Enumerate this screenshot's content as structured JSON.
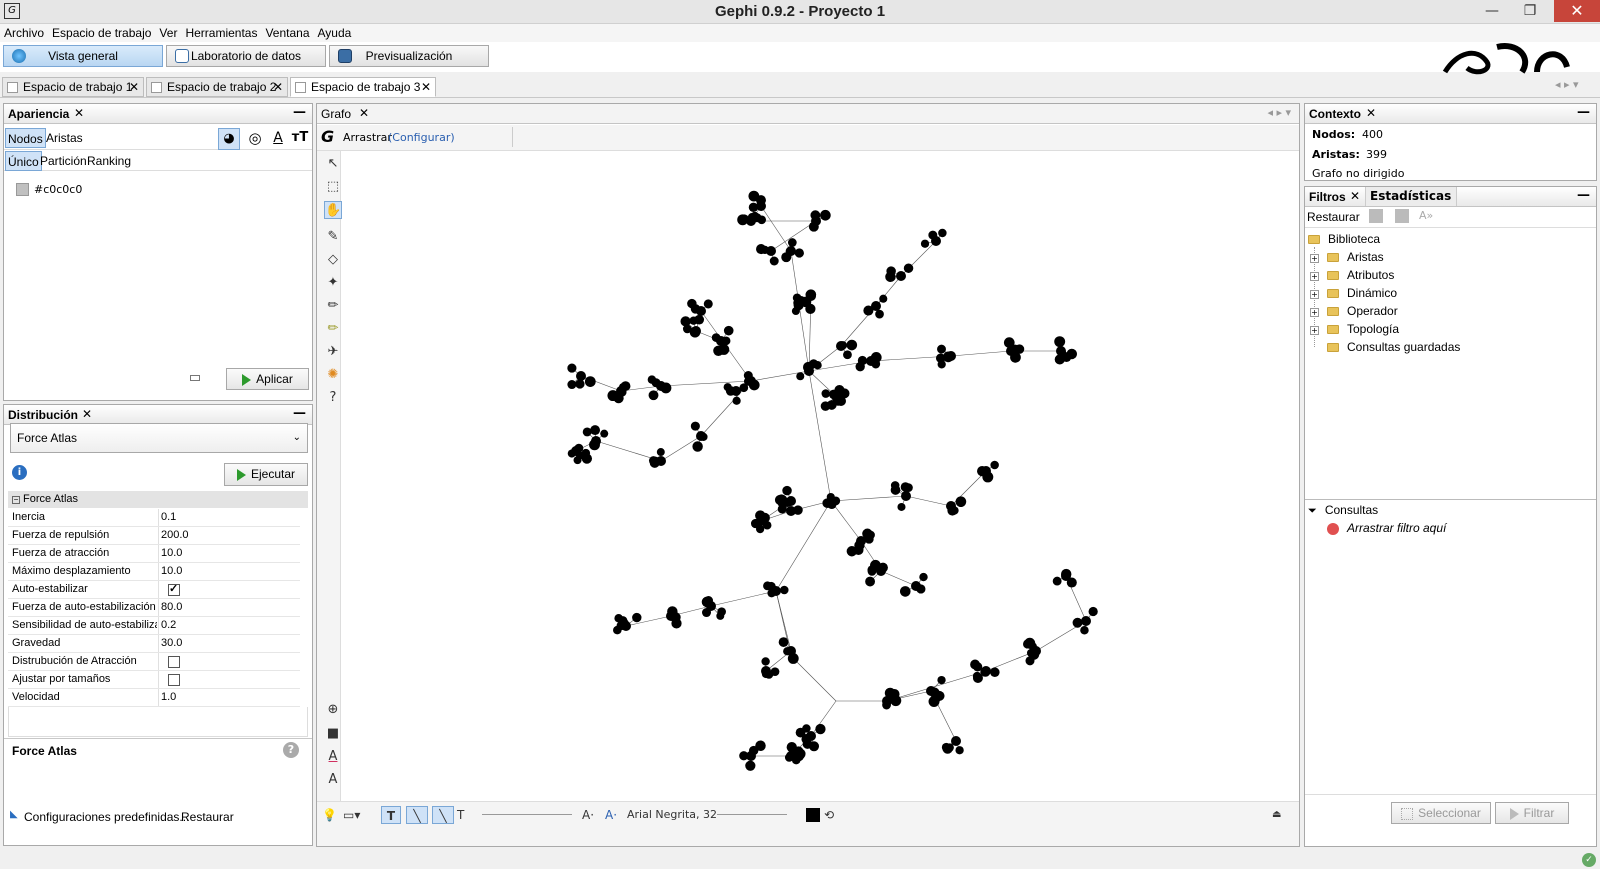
{
  "window": {
    "title": "Gephi 0.9.2 - Proyecto 1",
    "app_icon": "gephi-logo-icon",
    "minimize": "—",
    "maximize": "❐",
    "close": "✕"
  },
  "menu": [
    "Archivo",
    "Espacio de trabajo",
    "Ver",
    "Herramientas",
    "Ventana",
    "Ayuda"
  ],
  "modes": [
    {
      "label": "Vista general",
      "icon": "globe-icon",
      "active": true
    },
    {
      "label": "Laboratorio de datos",
      "icon": "table-icon",
      "active": false
    },
    {
      "label": "Previsualización",
      "icon": "monitor-icon",
      "active": false
    }
  ],
  "workspace_tabs": [
    "Espacio de trabajo 1",
    "Espacio de trabajo 2",
    "Espacio de trabajo 3"
  ],
  "active_workspace_tab": 2,
  "appearance": {
    "title": "Apariencia",
    "element_tabs": [
      "Nodos",
      "Aristas"
    ],
    "mode_tabs": [
      "Único",
      "Partición",
      "Ranking"
    ],
    "color_value": "#c0c0c0",
    "apply_label": "Aplicar"
  },
  "layout_panel": {
    "title": "Distribución",
    "algorithm": "Force Atlas",
    "run_label": "Ejecutar",
    "section": "Force Atlas",
    "properties": [
      {
        "name": "Inercia",
        "value": "0.1"
      },
      {
        "name": "Fuerza de repulsión",
        "value": "200.0"
      },
      {
        "name": "Fuerza de atracción",
        "value": "10.0"
      },
      {
        "name": "Máximo desplazamiento",
        "value": "10.0"
      },
      {
        "name": "Auto-estabilizar",
        "checked": true
      },
      {
        "name": "Fuerza de auto-estabilización",
        "value": "80.0"
      },
      {
        "name": "Sensibilidad de auto-estabiliza",
        "value": "0.2"
      },
      {
        "name": "Gravedad",
        "value": "30.0"
      },
      {
        "name": "Distrubución de Atracción",
        "checked": false
      },
      {
        "name": "Ajustar por tamaños",
        "checked": false
      },
      {
        "name": "Velocidad",
        "value": "1.0"
      }
    ],
    "description_title": "Force Atlas",
    "presets_label": "Configuraciones predefinidas...",
    "reset_label": "Restaurar"
  },
  "graph_panel": {
    "title": "Grafo",
    "tool_label": "Arrastrar",
    "configure_label": "(Configurar)",
    "font_label": "Arial Negrita, 32"
  },
  "context": {
    "title": "Contexto",
    "nodes_label": "Nodos:",
    "nodes_value": "400",
    "edges_label": "Aristas:",
    "edges_value": "399",
    "graph_type": "Grafo no dirigido"
  },
  "filters": {
    "tabs": [
      "Filtros",
      "Estadísticas"
    ],
    "reset_label": "Restaurar",
    "library_label": "Biblioteca",
    "categories": [
      "Aristas",
      "Atributos",
      "Dinámico",
      "Operador",
      "Topología",
      "Consultas guardadas"
    ],
    "queries_label": "Consultas",
    "drop_hint": "Arrastrar filtro aquí",
    "select_label": "Seleccionar",
    "filter_label": "Filtrar"
  },
  "colors": {
    "accent": "#cfe2f7",
    "node": "#000000",
    "run_green": "#2d9a2d"
  }
}
